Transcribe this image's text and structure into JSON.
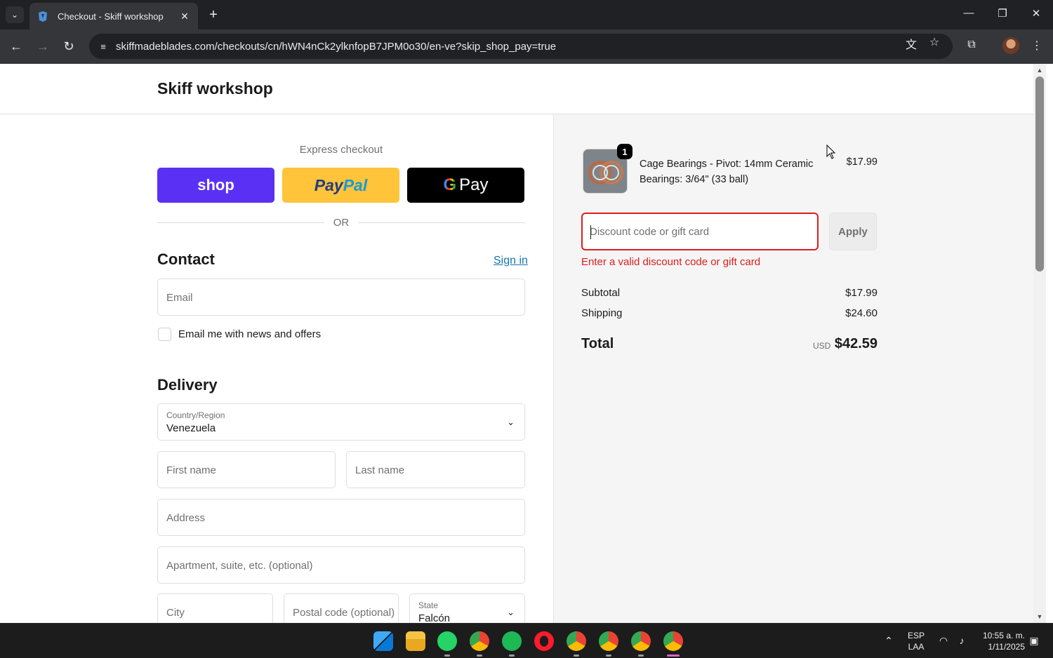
{
  "browser": {
    "tab_title": "Checkout - Skiff workshop",
    "url": "skiffmadeblades.com/checkouts/cn/hWN4nCk2ylknfopB7JPM0o30/en-ve?skip_shop_pay=true"
  },
  "store": {
    "name": "Skiff workshop"
  },
  "express": {
    "label": "Express checkout",
    "shop_label": "shop",
    "paypal_part1": "Pay",
    "paypal_part2": "Pal",
    "gpay_label": "Pay",
    "or_label": "OR"
  },
  "contact": {
    "title": "Contact",
    "sign_in": "Sign in",
    "email_placeholder": "Email",
    "news_label": "Email me with news and offers"
  },
  "delivery": {
    "title": "Delivery",
    "country_label": "Country/Region",
    "country_value": "Venezuela",
    "first_name": "First name",
    "last_name": "Last name",
    "address": "Address",
    "apartment": "Apartment, suite, etc. (optional)",
    "city": "City",
    "postal": "Postal code (optional)",
    "state_label": "State",
    "state_value": "Falcón"
  },
  "summary": {
    "product_name": "Cage Bearings - Pivot: 14mm Ceramic Bearings: 3/64\" (33 ball)",
    "product_qty": "1",
    "product_price": "$17.99",
    "discount_placeholder": "Discount code or gift card",
    "apply_label": "Apply",
    "error": "Enter a valid discount code or gift card",
    "subtotal_label": "Subtotal",
    "subtotal_value": "$17.99",
    "shipping_label": "Shipping",
    "shipping_value": "$24.60",
    "total_label": "Total",
    "total_currency": "USD",
    "total_value": "$42.59"
  },
  "system": {
    "lang_top": "ESP",
    "lang_bottom": "LAA",
    "time": "10:55 a. m.",
    "date": "1/11/2025"
  },
  "colors": {
    "shop_purple": "#5a31f4",
    "paypal_yellow": "#ffc439",
    "error_red": "#dd1d1d",
    "link_blue": "#1773b0"
  }
}
